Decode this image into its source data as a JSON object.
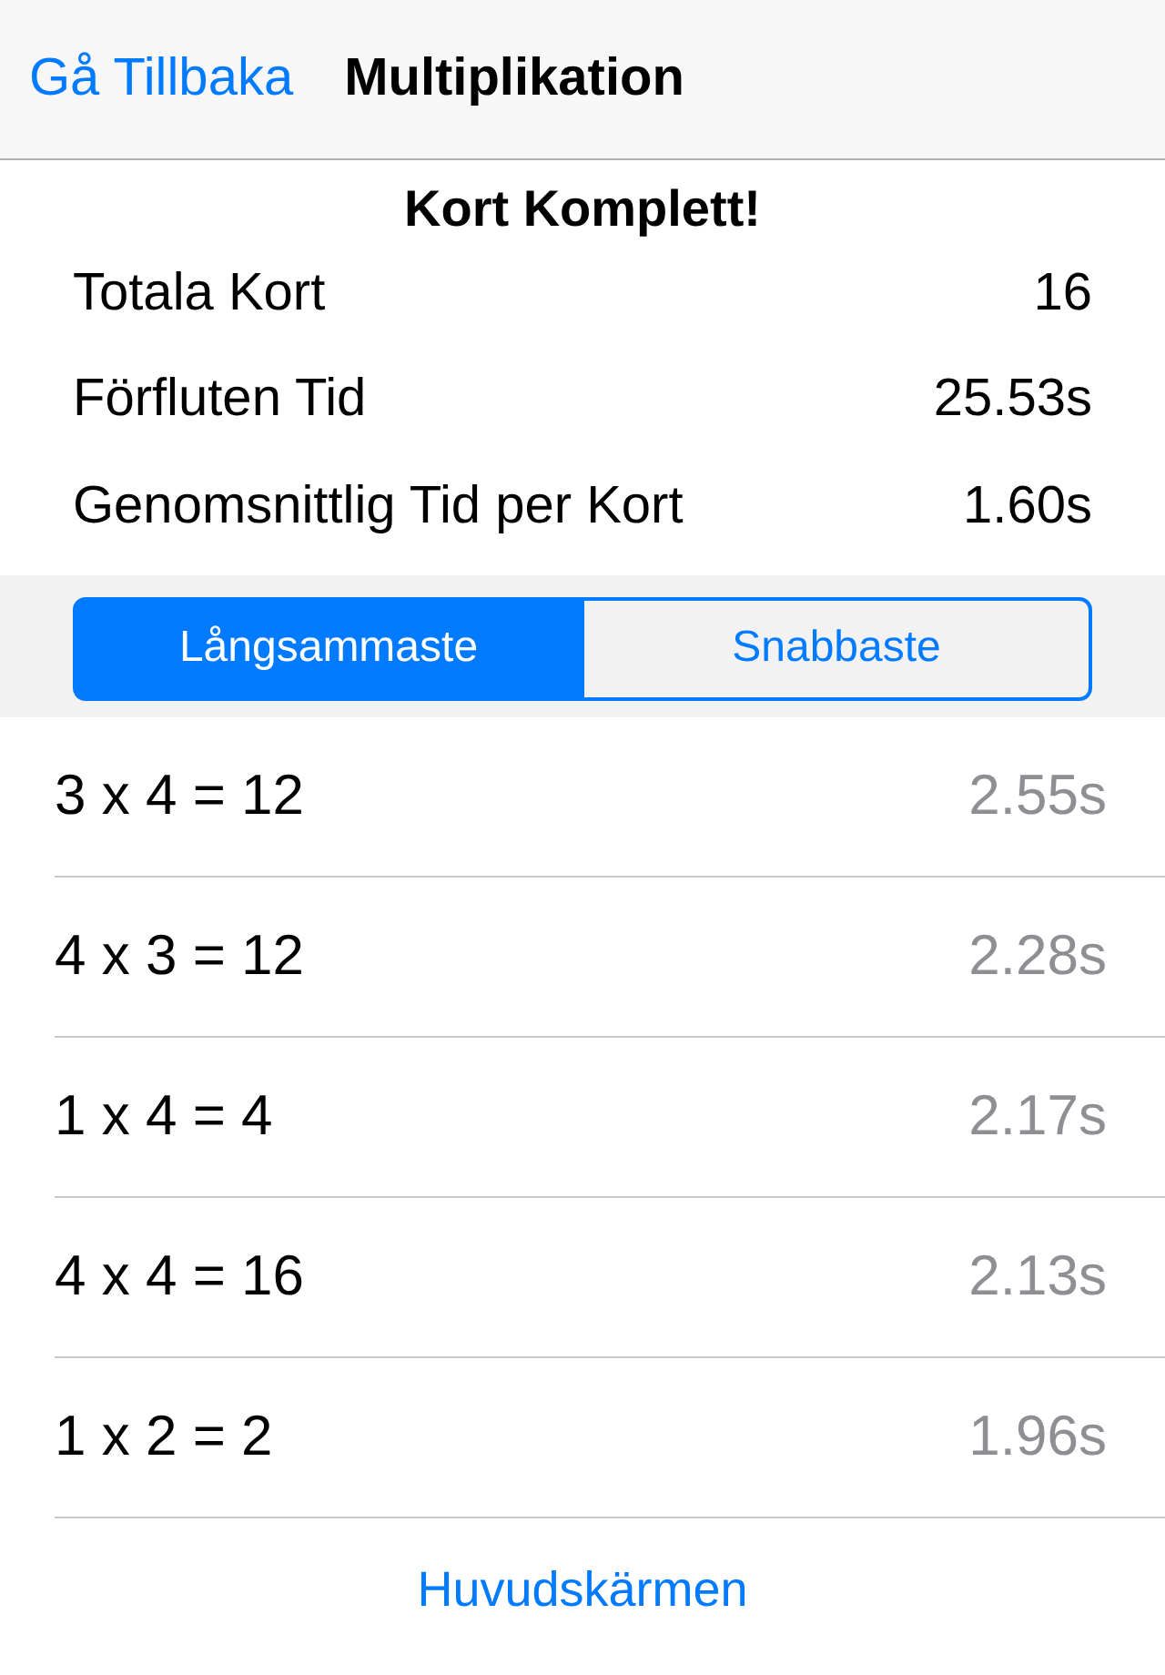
{
  "nav": {
    "back": "Gå Tillbaka",
    "title": "Multiplikation"
  },
  "summary": {
    "title": "Kort Komplett!",
    "stats": [
      {
        "label": "Totala Kort",
        "value": "16"
      },
      {
        "label": "Förfluten Tid",
        "value": "25.53s"
      },
      {
        "label": "Genomsnittlig Tid per Kort",
        "value": "1.60s"
      }
    ]
  },
  "segments": [
    {
      "label": "Långsammaste",
      "selected": true
    },
    {
      "label": "Snabbaste",
      "selected": false
    }
  ],
  "results": [
    {
      "equation": "3 x 4 = 12",
      "time": "2.55s"
    },
    {
      "equation": "4 x 3 = 12",
      "time": "2.28s"
    },
    {
      "equation": "1 x 4 = 4",
      "time": "2.17s"
    },
    {
      "equation": "4 x 4 = 16",
      "time": "2.13s"
    },
    {
      "equation": "1 x 2 = 2",
      "time": "1.96s"
    }
  ],
  "footer_link": "Huvudskärmen"
}
